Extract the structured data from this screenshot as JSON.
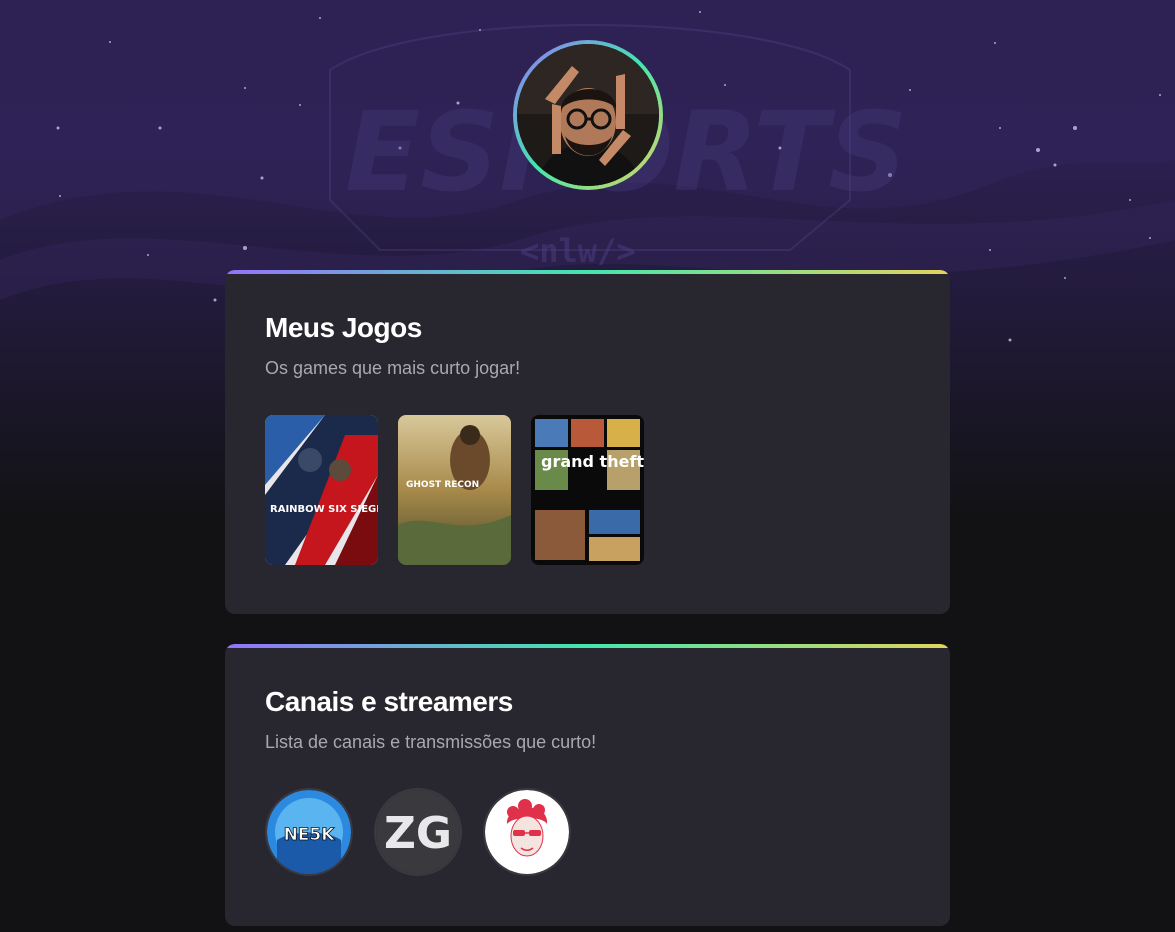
{
  "hero": {
    "logo_text": "ESPORTS",
    "tag_text": "<nlw/>"
  },
  "profile": {
    "avatar_icon": "profile-photo"
  },
  "games_section": {
    "title": "Meus Jogos",
    "subtitle": "Os games que mais curto jogar!",
    "games": [
      {
        "name": "Rainbow Six Siege",
        "cover_text": "RAINBOW SIX SIEGE"
      },
      {
        "name": "Ghost Recon",
        "cover_text": "GHOST RECON"
      },
      {
        "name": "Grand Theft Auto V",
        "cover_text": "grand theft auto"
      }
    ]
  },
  "streamers_section": {
    "title": "Canais e streamers",
    "subtitle": "Lista de canais e transmissões que curto!",
    "streamers": [
      {
        "name": "NE5K",
        "logo_text": "NE5K"
      },
      {
        "name": "ZG",
        "logo_text": "ZG"
      },
      {
        "name": "red-hair streamer"
      }
    ]
  },
  "colors": {
    "gradient_start": "#9572fc",
    "gradient_mid": "#43e7ad",
    "gradient_end": "#e2d45c",
    "card_bg": "#28262e",
    "page_bg": "#121214"
  }
}
